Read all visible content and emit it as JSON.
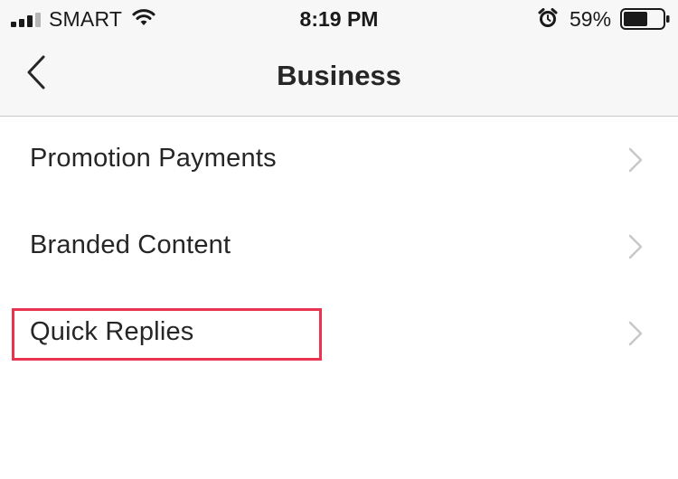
{
  "status_bar": {
    "carrier": "SMART",
    "time": "8:19 PM",
    "battery_percent": "59%",
    "icons": [
      "signal-icon",
      "wifi-icon",
      "alarm-clock-icon",
      "battery-icon"
    ]
  },
  "nav": {
    "title": "Business",
    "back_icon": "chevron-left-icon"
  },
  "list": {
    "items": [
      {
        "label": "Promotion Payments",
        "icon": "chevron-right-icon"
      },
      {
        "label": "Branded Content",
        "icon": "chevron-right-icon"
      },
      {
        "label": "Quick Replies",
        "icon": "chevron-right-icon",
        "highlighted": true
      }
    ]
  },
  "colors": {
    "background": "#ffffff",
    "bar_background": "#f7f7f7",
    "text": "#262626",
    "chevron": "#c7c7cc",
    "highlight": "#e8344e"
  }
}
